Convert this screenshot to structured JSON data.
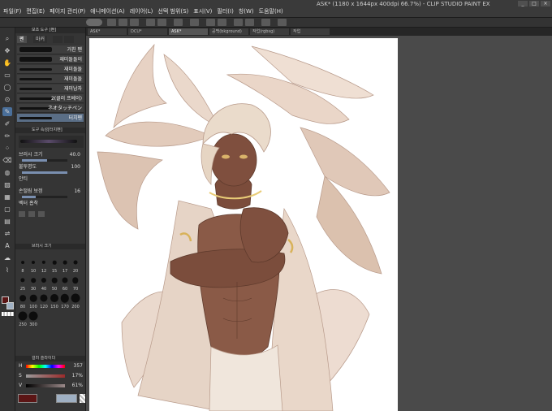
{
  "window": {
    "title": "ASK* (1180 x 1644px 400dpi 66.7%) - CLIP STUDIO PAINT EX",
    "controls": [
      "_",
      "□",
      "×"
    ]
  },
  "menu": [
    "파일(F)",
    "편집(E)",
    "페이지 관리(P)",
    "애니메이션(A)",
    "레이어(L)",
    "선택 범위(S)",
    "표시(V)",
    "필터(I)",
    "창(W)",
    "도움말(H)"
  ],
  "canvas_tabs": [
    "ASK*",
    "DCU*",
    "ASK*",
    "공백(bkground)",
    "작업(rgbsg)",
    "작업"
  ],
  "active_tab_index": 2,
  "tool_icons": [
    "zoom-icon",
    "move-icon",
    "hand-icon",
    "select-icon",
    "lasso-icon",
    "eyedropper-icon",
    "pen-icon",
    "pencil-icon",
    "brush-icon",
    "airbrush-icon",
    "eraser-icon",
    "blend-icon",
    "fill-icon",
    "gradient-icon",
    "figure-icon",
    "frame-icon",
    "ruler-icon",
    "text-icon",
    "balloon-icon",
    "correct-line-icon"
  ],
  "brush_panel": {
    "header": "보조 도구 [펜]",
    "tabs": [
      "펜",
      "마커",
      "",
      ""
    ],
    "brushes": [
      {
        "label": "거친 펜",
        "active": false
      },
      {
        "label": "재미돌돌이",
        "active": false
      },
      {
        "label": "재미돌돌",
        "active": false
      },
      {
        "label": "재미돌돌",
        "active": false
      },
      {
        "label": "재미남자",
        "active": false
      },
      {
        "label": "2(클러 프베이)",
        "active": false
      },
      {
        "label": "ネオタッチペン",
        "active": false
      },
      {
        "label": "터치펜",
        "active": true
      }
    ]
  },
  "tool_property": {
    "header": "도구 속성[터치펜]",
    "brush_name": "터치펜",
    "rows": [
      {
        "label": "브러시 크기",
        "value": "40.0",
        "fill": 0.55
      },
      {
        "label": "불투명도",
        "value": "100",
        "fill": 1.0
      },
      {
        "label": "안티",
        "value": ""
      },
      {
        "label": "손떨림 보정",
        "value": "16",
        "fill": 0.3
      },
      {
        "label": "벡터 흡착",
        "value": ""
      }
    ]
  },
  "brush_size_panel": {
    "header": "브러시 크기",
    "sizes": [
      "8",
      "10",
      "12",
      "15",
      "17",
      "20",
      "25",
      "30",
      "40",
      "50",
      "60",
      "70",
      "80",
      "100",
      "120",
      "150",
      "170",
      "200",
      "250",
      "300"
    ]
  },
  "color_slider": {
    "header": "컬러 슬라이더",
    "rows": [
      {
        "label": "H",
        "value": "357"
      },
      {
        "label": "S",
        "value": "17%"
      },
      {
        "label": "V",
        "value": "61%"
      }
    ]
  },
  "colors": {
    "main": "#5b1515",
    "sub": "#9fb0c3",
    "accent": "#4a6f9a"
  },
  "canvas": {
    "description": "anime-style digital illustration: dark-skinned winged figure with tousled light hair, arms crossed, white wrap"
  }
}
